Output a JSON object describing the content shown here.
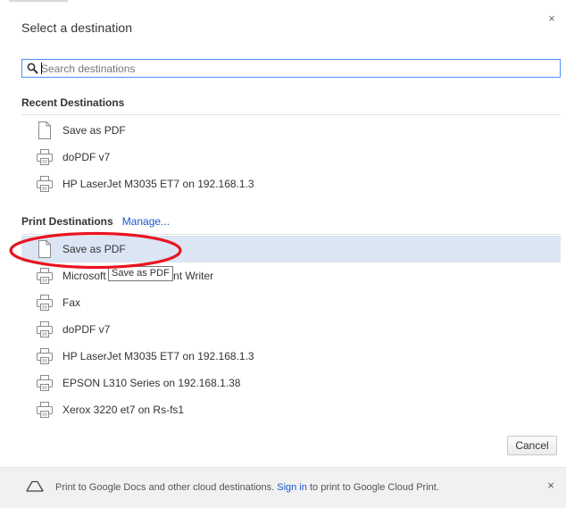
{
  "dialog": {
    "title": "Select a destination",
    "close_glyph": "×"
  },
  "search": {
    "placeholder": "Search destinations",
    "value": ""
  },
  "recent": {
    "heading": "Recent Destinations",
    "items": [
      {
        "label": "Save as PDF",
        "icon": "document-icon"
      },
      {
        "label": "doPDF v7",
        "icon": "printer-icon"
      },
      {
        "label": "HP LaserJet M3035 ET7 on 192.168.1.3",
        "icon": "printer-icon"
      }
    ]
  },
  "print": {
    "heading": "Print Destinations",
    "manage_label": "Manage...",
    "items": [
      {
        "label": "Save as PDF",
        "icon": "document-icon",
        "selected": true
      },
      {
        "label": "Microsoft XPS Document Writer",
        "icon": "printer-icon"
      },
      {
        "label": "Fax",
        "icon": "printer-icon"
      },
      {
        "label": "doPDF v7",
        "icon": "printer-icon"
      },
      {
        "label": "HP LaserJet M3035 ET7 on 192.168.1.3",
        "icon": "printer-icon"
      },
      {
        "label": "EPSON L310 Series on 192.168.1.38",
        "icon": "printer-icon"
      },
      {
        "label": "Xerox 3220 et7 on Rs-fs1",
        "icon": "printer-icon"
      }
    ]
  },
  "tooltip": {
    "text": "Save as PDF"
  },
  "buttons": {
    "cancel_label": "Cancel"
  },
  "footer": {
    "text_before": "Print to Google Docs and other cloud destinations.",
    "link": "Sign in",
    "text_after": "to print to Google Cloud Print.",
    "close_glyph": "×"
  },
  "colors": {
    "accent_link": "#1a58c9",
    "selected_row": "#dbe5f4",
    "highlight_ellipse": "#e8141f",
    "search_focus_border": "#4d90fe"
  }
}
